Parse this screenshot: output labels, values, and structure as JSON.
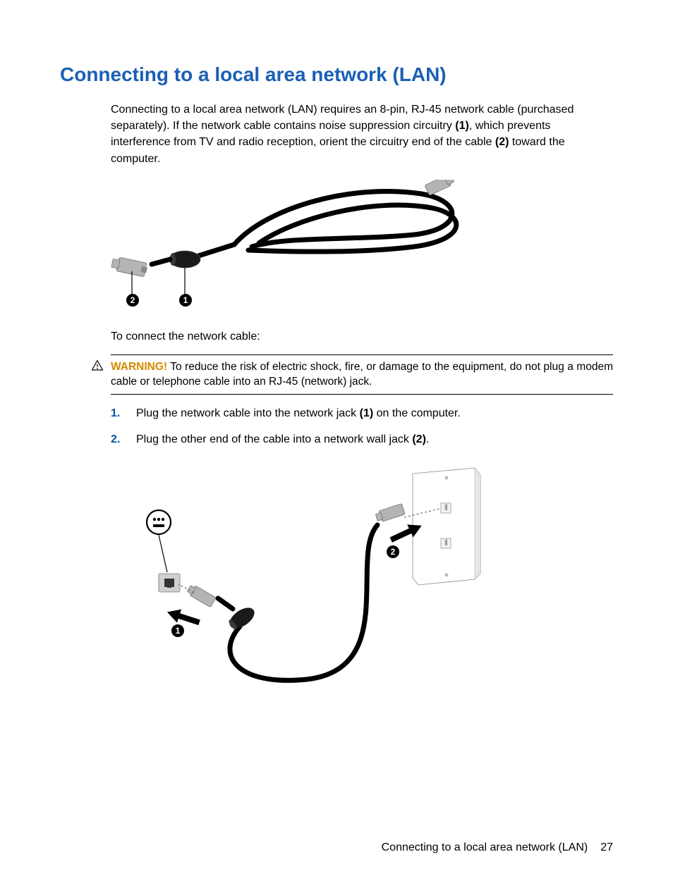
{
  "heading": "Connecting to a local area network (LAN)",
  "intro": {
    "part1": "Connecting to a local area network (LAN) requires an 8-pin, RJ-45 network cable (purchased separately). If the network cable contains noise suppression circuitry ",
    "bold1": "(1)",
    "part2": ", which prevents interference from TV and radio reception, orient the circuitry end of the cable ",
    "bold2": "(2)",
    "part3": " toward the computer."
  },
  "sub_intro": "To connect the network cable:",
  "warning": {
    "label": "WARNING!",
    "text": "   To reduce the risk of electric shock, fire, or damage to the equipment, do not plug a modem cable or telephone cable into an RJ-45 (network) jack."
  },
  "steps": [
    {
      "num": "1.",
      "pre": "Plug the network cable into the network jack ",
      "bold": "(1)",
      "post": " on the computer."
    },
    {
      "num": "2.",
      "pre": "Plug the other end of the cable into a network wall jack ",
      "bold": "(2)",
      "post": "."
    }
  ],
  "callouts": {
    "one": "1",
    "two": "2"
  },
  "footer": {
    "title": "Connecting to a local area network (LAN)",
    "page": "27"
  }
}
